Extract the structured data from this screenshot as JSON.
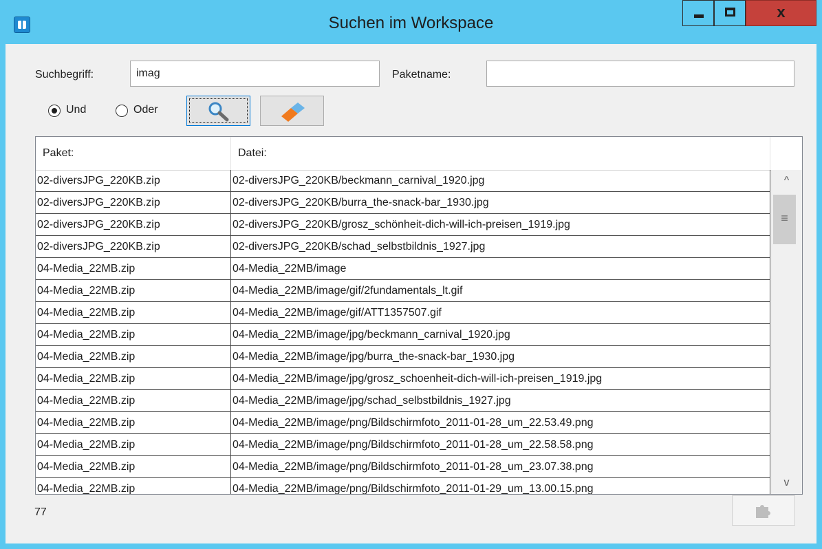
{
  "window": {
    "title": "Suchen im Workspace",
    "close_glyph": "x",
    "colors": {
      "frame": "#5ac8f0",
      "close": "#c5413b",
      "client": "#f0f0f0"
    }
  },
  "search": {
    "term_label": "Suchbegriff:",
    "term_value": "imag",
    "package_label": "Paketname:",
    "package_value": "",
    "and_label": "Und",
    "or_label": "Oder",
    "mode_selected": "Und",
    "search_icon": "magnifier-icon",
    "clear_icon": "eraser-icon"
  },
  "table": {
    "headers": [
      "Paket:",
      "Datei:"
    ],
    "rows": [
      [
        "02-diversJPG_220KB.zip",
        "02-diversJPG_220KB/beckmann_carnival_1920.jpg"
      ],
      [
        "02-diversJPG_220KB.zip",
        "02-diversJPG_220KB/burra_the-snack-bar_1930.jpg"
      ],
      [
        "02-diversJPG_220KB.zip",
        "02-diversJPG_220KB/grosz_schönheit-dich-will-ich-preisen_1919.jpg"
      ],
      [
        "02-diversJPG_220KB.zip",
        "02-diversJPG_220KB/schad_selbstbildnis_1927.jpg"
      ],
      [
        "04-Media_22MB.zip",
        "04-Media_22MB/image"
      ],
      [
        "04-Media_22MB.zip",
        "04-Media_22MB/image/gif/2fundamentals_lt.gif"
      ],
      [
        "04-Media_22MB.zip",
        "04-Media_22MB/image/gif/ATT1357507.gif"
      ],
      [
        "04-Media_22MB.zip",
        "04-Media_22MB/image/jpg/beckmann_carnival_1920.jpg"
      ],
      [
        "04-Media_22MB.zip",
        "04-Media_22MB/image/jpg/burra_the-snack-bar_1930.jpg"
      ],
      [
        "04-Media_22MB.zip",
        "04-Media_22MB/image/jpg/grosz_schoenheit-dich-will-ich-preisen_1919.jpg"
      ],
      [
        "04-Media_22MB.zip",
        "04-Media_22MB/image/jpg/schad_selbstbildnis_1927.jpg"
      ],
      [
        "04-Media_22MB.zip",
        "04-Media_22MB/image/png/Bildschirmfoto_2011-01-28_um_22.53.49.png"
      ],
      [
        "04-Media_22MB.zip",
        "04-Media_22MB/image/png/Bildschirmfoto_2011-01-28_um_22.58.58.png"
      ],
      [
        "04-Media_22MB.zip",
        "04-Media_22MB/image/png/Bildschirmfoto_2011-01-28_um_23.07.38.png"
      ],
      [
        "04-Media_22MB.zip",
        "04-Media_22MB/image/png/Bildschirmfoto_2011-01-29_um_13.00.15.png"
      ]
    ]
  },
  "status": {
    "count": "77"
  }
}
